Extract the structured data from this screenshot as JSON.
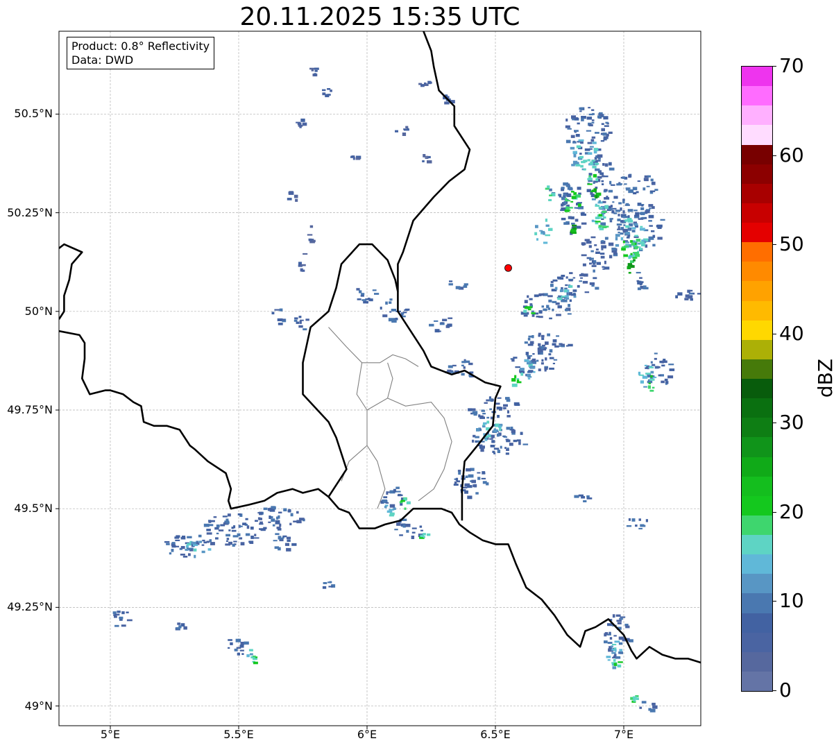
{
  "title": "20.11.2025 15:35 UTC",
  "info_box": {
    "product": "Product: 0.8° Reflectivity",
    "data_source": "Data: DWD"
  },
  "map": {
    "lon_range": [
      4.8,
      7.3
    ],
    "lat_range": [
      48.95,
      50.71
    ],
    "lat_ticks": [
      {
        "value": 50.5,
        "label": "50.5°N"
      },
      {
        "value": 50.25,
        "label": "50.25°N"
      },
      {
        "value": 50.0,
        "label": "50°N"
      },
      {
        "value": 49.75,
        "label": "49.75°N"
      },
      {
        "value": 49.5,
        "label": "49.5°N"
      },
      {
        "value": 49.25,
        "label": "49.25°N"
      },
      {
        "value": 49.0,
        "label": "49°N"
      }
    ],
    "lon_ticks": [
      {
        "value": 5.0,
        "label": "5°E"
      },
      {
        "value": 5.5,
        "label": "5.5°E"
      },
      {
        "value": 6.0,
        "label": "6°E"
      },
      {
        "value": 6.5,
        "label": "6.5°E"
      },
      {
        "value": 7.0,
        "label": "7°E"
      }
    ],
    "gridlines": true,
    "radar_site": {
      "lon": 6.55,
      "lat": 50.11,
      "color": "#ff0000"
    },
    "borders": [
      [
        [
          4.8,
          50.16
        ],
        [
          4.82,
          50.17
        ],
        [
          4.89,
          50.15
        ],
        [
          4.85,
          50.12
        ],
        [
          4.84,
          50.08
        ],
        [
          4.82,
          50.04
        ],
        [
          4.82,
          50.0
        ],
        [
          4.8,
          49.98
        ]
      ],
      [
        [
          4.8,
          49.95
        ],
        [
          4.88,
          49.94
        ],
        [
          4.9,
          49.92
        ],
        [
          4.9,
          49.88
        ],
        [
          4.89,
          49.83
        ],
        [
          4.92,
          49.79
        ],
        [
          4.98,
          49.8
        ],
        [
          5.0,
          49.8
        ],
        [
          5.05,
          49.79
        ],
        [
          5.09,
          49.77
        ],
        [
          5.12,
          49.76
        ],
        [
          5.13,
          49.72
        ],
        [
          5.17,
          49.71
        ],
        [
          5.22,
          49.71
        ],
        [
          5.27,
          49.7
        ],
        [
          5.31,
          49.66
        ],
        [
          5.33,
          49.65
        ],
        [
          5.38,
          49.62
        ],
        [
          5.45,
          49.59
        ],
        [
          5.47,
          49.55
        ],
        [
          5.46,
          49.52
        ],
        [
          5.47,
          49.5
        ],
        [
          5.54,
          49.51
        ],
        [
          5.6,
          49.52
        ],
        [
          5.65,
          49.54
        ],
        [
          5.71,
          49.55
        ],
        [
          5.75,
          49.54
        ],
        [
          5.81,
          49.55
        ],
        [
          5.85,
          49.53
        ]
      ],
      [
        [
          5.85,
          49.53
        ],
        [
          5.89,
          49.5
        ],
        [
          5.93,
          49.49
        ],
        [
          5.97,
          49.45
        ],
        [
          6.03,
          49.45
        ],
        [
          6.07,
          49.46
        ],
        [
          6.13,
          49.47
        ],
        [
          6.18,
          49.5
        ],
        [
          6.24,
          49.5
        ],
        [
          6.29,
          49.5
        ],
        [
          6.33,
          49.49
        ],
        [
          6.36,
          49.46
        ],
        [
          6.4,
          49.44
        ],
        [
          6.45,
          49.42
        ],
        [
          6.5,
          49.41
        ],
        [
          6.55,
          49.41
        ],
        [
          6.58,
          49.36
        ],
        [
          6.62,
          49.3
        ],
        [
          6.68,
          49.27
        ],
        [
          6.73,
          49.23
        ],
        [
          6.78,
          49.18
        ],
        [
          6.83,
          49.15
        ],
        [
          6.85,
          49.19
        ],
        [
          6.89,
          49.2
        ],
        [
          6.94,
          49.22
        ],
        [
          7.0,
          49.18
        ],
        [
          7.03,
          49.14
        ],
        [
          7.05,
          49.12
        ],
        [
          7.1,
          49.15
        ],
        [
          7.15,
          49.13
        ],
        [
          7.2,
          49.12
        ],
        [
          7.25,
          49.12
        ],
        [
          7.3,
          49.11
        ]
      ],
      [
        [
          6.37,
          49.47
        ],
        [
          6.37,
          49.55
        ],
        [
          6.38,
          49.62
        ],
        [
          6.43,
          49.66
        ],
        [
          6.49,
          49.71
        ],
        [
          6.5,
          49.78
        ],
        [
          6.52,
          49.81
        ],
        [
          6.46,
          49.82
        ],
        [
          6.38,
          49.85
        ],
        [
          6.33,
          49.84
        ],
        [
          6.25,
          49.86
        ],
        [
          6.22,
          49.9
        ],
        [
          6.17,
          49.95
        ],
        [
          6.12,
          50.0
        ],
        [
          6.12,
          50.05
        ],
        [
          6.11,
          50.08
        ],
        [
          6.08,
          50.13
        ],
        [
          6.02,
          50.17
        ],
        [
          5.97,
          50.17
        ],
        [
          5.9,
          50.12
        ],
        [
          5.88,
          50.06
        ],
        [
          5.85,
          50.0
        ],
        [
          5.78,
          49.96
        ],
        [
          5.75,
          49.87
        ],
        [
          5.75,
          49.79
        ],
        [
          5.85,
          49.72
        ],
        [
          5.88,
          49.68
        ],
        [
          5.92,
          49.6
        ],
        [
          5.85,
          49.53
        ]
      ],
      [
        [
          6.12,
          50.05
        ],
        [
          6.12,
          50.12
        ],
        [
          6.14,
          50.15
        ],
        [
          6.18,
          50.23
        ],
        [
          6.26,
          50.29
        ],
        [
          6.32,
          50.33
        ],
        [
          6.38,
          50.36
        ],
        [
          6.4,
          50.41
        ],
        [
          6.34,
          50.47
        ],
        [
          6.34,
          50.52
        ],
        [
          6.28,
          50.56
        ],
        [
          6.26,
          50.62
        ],
        [
          6.25,
          50.66
        ],
        [
          6.22,
          50.71
        ]
      ]
    ],
    "inner_boundaries": [
      [
        [
          5.85,
          49.96
        ],
        [
          5.92,
          49.91
        ],
        [
          5.98,
          49.87
        ],
        [
          6.05,
          49.87
        ],
        [
          6.1,
          49.89
        ],
        [
          6.15,
          49.88
        ],
        [
          6.2,
          49.86
        ]
      ],
      [
        [
          5.98,
          49.87
        ],
        [
          5.96,
          49.79
        ],
        [
          6.0,
          49.75
        ],
        [
          6.0,
          49.66
        ],
        [
          6.04,
          49.62
        ],
        [
          6.07,
          49.55
        ],
        [
          6.04,
          49.5
        ]
      ],
      [
        [
          6.0,
          49.75
        ],
        [
          6.08,
          49.78
        ],
        [
          6.15,
          49.76
        ],
        [
          6.25,
          49.77
        ],
        [
          6.3,
          49.73
        ],
        [
          6.33,
          49.67
        ],
        [
          6.3,
          49.6
        ],
        [
          6.26,
          49.55
        ],
        [
          6.2,
          49.52
        ]
      ],
      [
        [
          6.0,
          49.66
        ],
        [
          5.93,
          49.62
        ],
        [
          5.9,
          49.57
        ]
      ],
      [
        [
          6.08,
          49.78
        ],
        [
          6.1,
          49.83
        ],
        [
          6.08,
          49.87
        ]
      ]
    ],
    "echo_groups": [
      {
        "level": 5,
        "cells": [
          [
            5.68,
            50.26,
            0.04,
            0.05
          ],
          [
            5.76,
            50.17,
            0.04,
            0.05
          ],
          [
            5.73,
            50.1,
            0.03,
            0.05
          ],
          [
            5.92,
            50.38,
            0.04,
            0.02
          ],
          [
            5.77,
            50.6,
            0.03,
            0.02
          ],
          [
            5.82,
            50.55,
            0.05,
            0.02
          ],
          [
            5.72,
            50.47,
            0.03,
            0.02
          ],
          [
            6.1,
            50.45,
            0.06,
            0.03
          ],
          [
            6.2,
            50.57,
            0.04,
            0.02
          ],
          [
            6.28,
            50.52,
            0.05,
            0.03
          ],
          [
            6.2,
            50.38,
            0.05,
            0.02
          ]
        ]
      },
      {
        "level": 9,
        "cells": [
          [
            6.76,
            50.4,
            0.18,
            0.12
          ],
          [
            6.84,
            50.28,
            0.12,
            0.12
          ],
          [
            6.9,
            50.2,
            0.12,
            0.1
          ],
          [
            6.7,
            50.27,
            0.09,
            0.07
          ],
          [
            6.75,
            50.2,
            0.1,
            0.12
          ],
          [
            6.82,
            50.1,
            0.14,
            0.1
          ],
          [
            6.95,
            50.3,
            0.2,
            0.05
          ],
          [
            6.97,
            50.16,
            0.18,
            0.12
          ],
          [
            7.03,
            50.05,
            0.06,
            0.06
          ],
          [
            7.19,
            50.02,
            0.1,
            0.04
          ],
          [
            6.7,
            50.04,
            0.2,
            0.06
          ],
          [
            6.58,
            49.98,
            0.22,
            0.07
          ],
          [
            6.6,
            49.9,
            0.2,
            0.05
          ],
          [
            6.55,
            49.84,
            0.18,
            0.07
          ],
          [
            6.38,
            49.73,
            0.2,
            0.06
          ],
          [
            6.4,
            49.64,
            0.22,
            0.08
          ],
          [
            6.33,
            49.53,
            0.14,
            0.08
          ],
          [
            6.05,
            49.5,
            0.09,
            0.06
          ],
          [
            6.1,
            49.43,
            0.12,
            0.05
          ],
          [
            5.2,
            49.38,
            0.2,
            0.06
          ],
          [
            5.35,
            49.41,
            0.25,
            0.08
          ],
          [
            5.55,
            49.45,
            0.2,
            0.06
          ],
          [
            5.63,
            49.39,
            0.08,
            0.06
          ],
          [
            5.82,
            49.3,
            0.04,
            0.02
          ],
          [
            5.0,
            49.2,
            0.08,
            0.05
          ],
          [
            5.25,
            49.19,
            0.04,
            0.03
          ],
          [
            5.45,
            49.13,
            0.08,
            0.05
          ],
          [
            6.05,
            49.98,
            0.1,
            0.06
          ],
          [
            5.95,
            50.02,
            0.08,
            0.05
          ],
          [
            6.24,
            49.95,
            0.09,
            0.04
          ],
          [
            5.7,
            49.95,
            0.08,
            0.04
          ],
          [
            5.62,
            49.97,
            0.06,
            0.04
          ],
          [
            6.3,
            49.83,
            0.14,
            0.05
          ],
          [
            7.08,
            49.8,
            0.1,
            0.1
          ],
          [
            7.0,
            49.45,
            0.1,
            0.03
          ],
          [
            6.92,
            49.12,
            0.1,
            0.12
          ],
          [
            7.05,
            48.99,
            0.07,
            0.03
          ],
          [
            6.8,
            49.52,
            0.08,
            0.02
          ],
          [
            6.3,
            50.06,
            0.08,
            0.02
          ]
        ]
      },
      {
        "level": 15,
        "cells": [
          [
            6.78,
            50.36,
            0.12,
            0.08
          ],
          [
            6.85,
            50.22,
            0.08,
            0.08
          ],
          [
            6.65,
            50.17,
            0.06,
            0.07
          ],
          [
            6.96,
            50.14,
            0.12,
            0.1
          ],
          [
            6.72,
            50.03,
            0.1,
            0.04
          ],
          [
            6.58,
            49.83,
            0.08,
            0.05
          ],
          [
            6.42,
            49.67,
            0.1,
            0.06
          ],
          [
            5.28,
            49.38,
            0.1,
            0.04
          ],
          [
            5.52,
            49.12,
            0.05,
            0.03
          ],
          [
            6.93,
            49.1,
            0.06,
            0.07
          ],
          [
            7.05,
            49.81,
            0.06,
            0.06
          ],
          [
            6.05,
            49.48,
            0.06,
            0.04
          ]
        ]
      },
      {
        "level": 22,
        "cells": [
          [
            6.75,
            50.25,
            0.08,
            0.06
          ],
          [
            6.88,
            50.2,
            0.06,
            0.07
          ],
          [
            6.98,
            50.12,
            0.08,
            0.08
          ],
          [
            6.85,
            50.31,
            0.05,
            0.04
          ],
          [
            6.6,
            49.99,
            0.05,
            0.03
          ],
          [
            6.12,
            49.5,
            0.04,
            0.03
          ],
          [
            6.2,
            49.42,
            0.04,
            0.02
          ],
          [
            6.55,
            49.81,
            0.04,
            0.03
          ],
          [
            5.55,
            49.11,
            0.02,
            0.02
          ],
          [
            7.02,
            49.01,
            0.03,
            0.02
          ],
          [
            6.95,
            49.1,
            0.03,
            0.03
          ],
          [
            7.09,
            49.8,
            0.03,
            0.04
          ],
          [
            6.68,
            50.28,
            0.04,
            0.04
          ]
        ]
      },
      {
        "level": 28,
        "cells": [
          [
            6.86,
            50.29,
            0.04,
            0.03
          ],
          [
            7.0,
            50.1,
            0.04,
            0.04
          ],
          [
            6.78,
            50.2,
            0.03,
            0.03
          ]
        ]
      }
    ]
  },
  "colorbar": {
    "label": "dBZ",
    "min": 0,
    "max": 70,
    "step": 2.5,
    "ticks": [
      {
        "value": 0,
        "label": "0"
      },
      {
        "value": 10,
        "label": "10"
      },
      {
        "value": 20,
        "label": "20"
      },
      {
        "value": 30,
        "label": "30"
      },
      {
        "value": 40,
        "label": "40"
      },
      {
        "value": 50,
        "label": "50"
      },
      {
        "value": 60,
        "label": "60"
      },
      {
        "value": 70,
        "label": "70"
      }
    ],
    "colors": [
      "#6474a6",
      "#56689e",
      "#4a64a2",
      "#4262a2",
      "#4a78b0",
      "#5896c4",
      "#60b8d8",
      "#5ed4c4",
      "#3ed66e",
      "#14c81e",
      "#14be1e",
      "#10aa18",
      "#10941a",
      "#0e7e14",
      "#0a7010",
      "#085c0c",
      "#467a0a",
      "#acb006",
      "#ffd800",
      "#ffba00",
      "#ffa200",
      "#ff8a00",
      "#ff6e00",
      "#e40000",
      "#c80000",
      "#a80000",
      "#8c0000",
      "#780000",
      "#ffdcff",
      "#ffb0ff",
      "#ff6cff",
      "#ee34ee"
    ]
  }
}
